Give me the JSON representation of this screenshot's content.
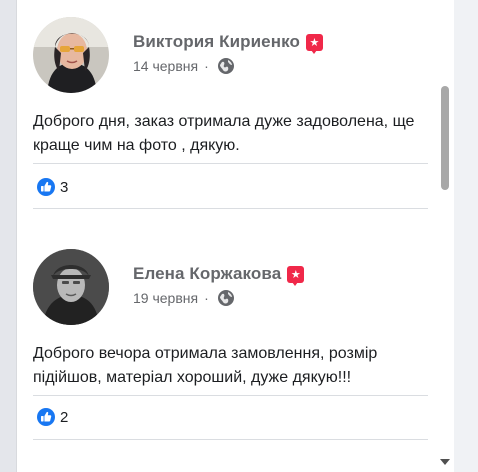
{
  "reviews": [
    {
      "author": "Виктория Кириенко",
      "date": "14 червня",
      "separator": "·",
      "text": "Доброго дня, заказ отримала дуже задоволена, ще краще чим на фото , дякую.",
      "reaction_count": "3",
      "recommend_icon": "recommend-icon",
      "privacy_icon": "globe-icon",
      "reaction_icon": "like-icon"
    },
    {
      "author": "Елена Коржакова",
      "date": "19 червня",
      "separator": "·",
      "text": "Доброго вечора отримала замовлення, розмір підійшов, матеріал хороший, дуже дякую!!!",
      "reaction_count": "2",
      "recommend_icon": "recommend-icon",
      "privacy_icon": "globe-icon",
      "reaction_icon": "like-icon"
    }
  ],
  "colors": {
    "like_blue": "#1877f2",
    "recommend_red": "#f02849",
    "secondary_text": "#65676b"
  }
}
